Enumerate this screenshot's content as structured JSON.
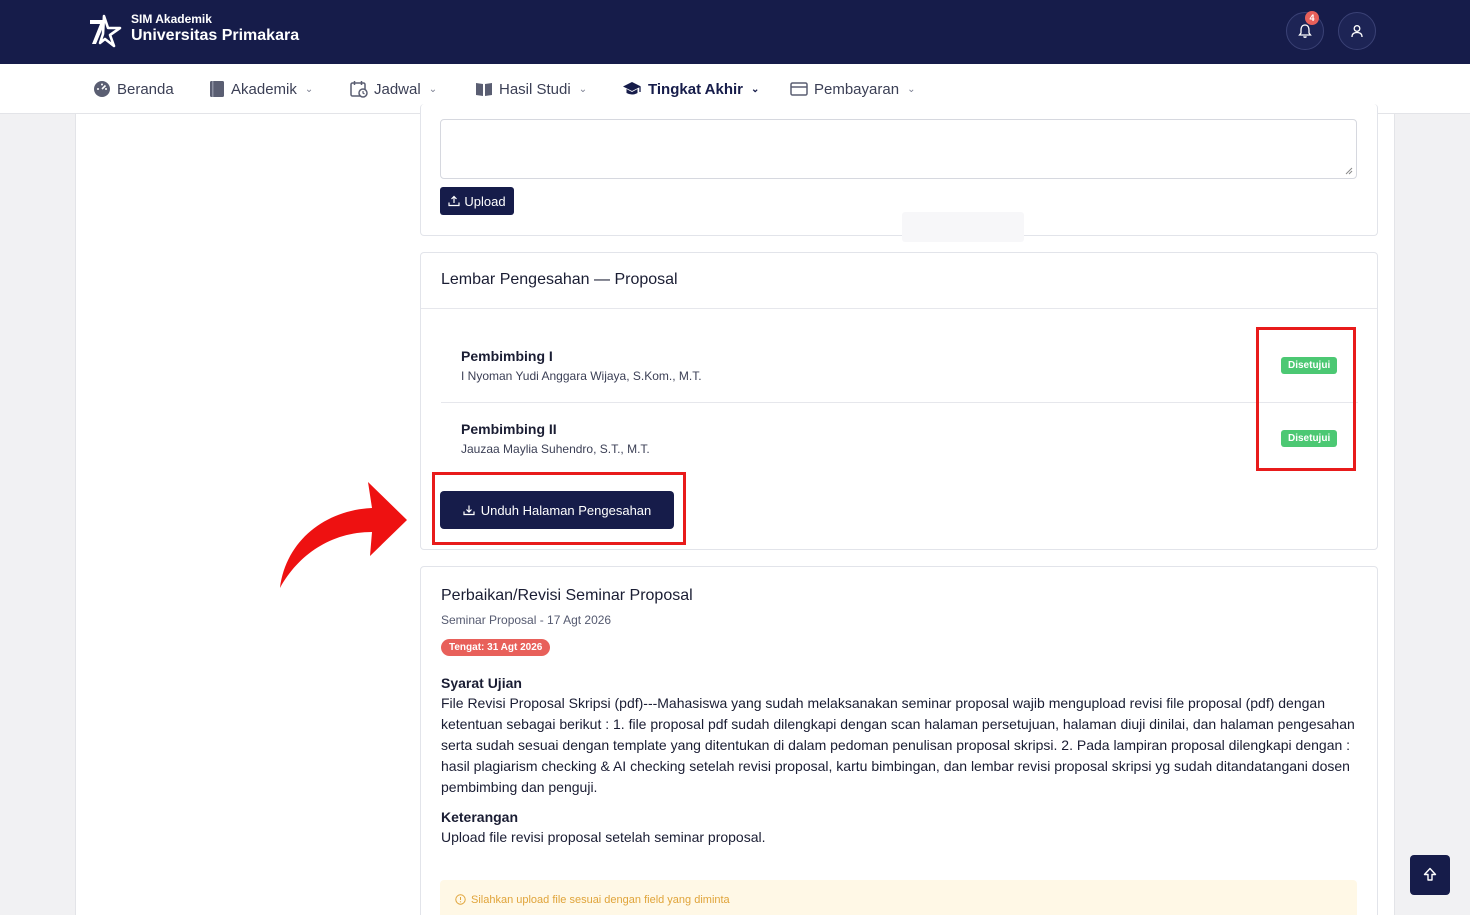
{
  "header": {
    "brand_sub": "SIM Akademik",
    "brand_main": "Universitas Primakara",
    "notification_count": "4"
  },
  "nav": {
    "items": [
      {
        "label": "Beranda",
        "icon": "dashboard-icon"
      },
      {
        "label": "Akademik",
        "icon": "book-icon"
      },
      {
        "label": "Jadwal",
        "icon": "calendar-clock-icon"
      },
      {
        "label": "Hasil Studi",
        "icon": "open-book-icon"
      },
      {
        "label": "Tingkat Akhir",
        "icon": "graduation-cap-icon"
      },
      {
        "label": "Pembayaran",
        "icon": "credit-card-icon"
      }
    ],
    "active": "Tingkat Akhir"
  },
  "upload_section": {
    "button_label": "Upload"
  },
  "approval_card": {
    "title": "Lembar Pengesahan — Proposal",
    "supervisors": [
      {
        "role": "Pembimbing I",
        "name": "I Nyoman Yudi Anggara Wijaya, S.Kom., M.T.",
        "status": "Disetujui"
      },
      {
        "role": "Pembimbing II",
        "name": "Jauzaa Maylia Suhendro, S.T., M.T.",
        "status": "Disetujui"
      }
    ],
    "download_label": "Unduh Halaman Pengesahan"
  },
  "revision_card": {
    "title": "Perbaikan/Revisi Seminar Proposal",
    "subtitle": "Seminar Proposal - 17 Agt 2026",
    "deadline_badge": "Tengat: 31 Agt 2026",
    "requirements_heading": "Syarat Ujian",
    "requirements_text": "File Revisi Proposal Skripsi (pdf)---Mahasiswa yang sudah melaksanakan seminar proposal wajib mengupload revisi file proposal (pdf) dengan ketentuan sebagai berikut : 1. file proposal pdf sudah dilengkapi dengan scan halaman persetujuan, halaman diuji dinilai, dan halaman pengesahan serta sudah sesuai dengan template yang ditentukan di dalam pedoman penulisan proposal skripsi. 2. Pada lampiran proposal dilengkapi dengan : hasil plagiarism checking & AI checking setelah revisi proposal, kartu bimbingan, dan lembar revisi proposal skripsi yg sudah ditandatangani dosen pembimbing dan penguji.",
    "notes_heading": "Keterangan",
    "notes_text": "Upload file revisi proposal setelah seminar proposal.",
    "alert_text": "Silahkan upload file sesuai dengan field yang diminta"
  },
  "colors": {
    "navy": "#161c4a",
    "approved": "#4cc873",
    "deadline": "#e8605a",
    "highlight": "#e81b1b",
    "warning_text": "#e0a43a"
  }
}
